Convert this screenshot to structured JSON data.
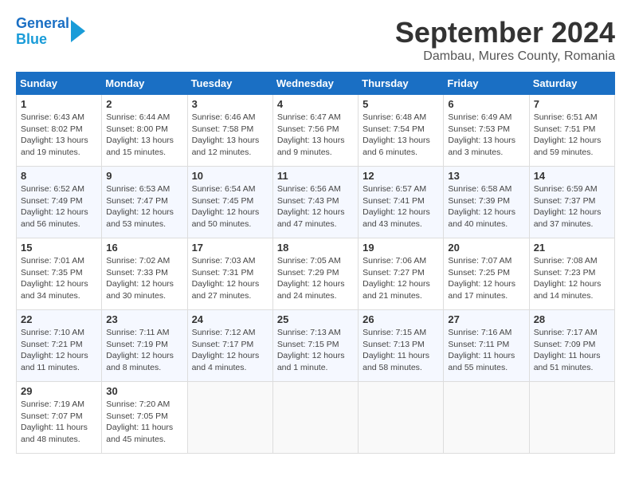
{
  "header": {
    "logo_line1": "General",
    "logo_line2": "Blue",
    "month_title": "September 2024",
    "subtitle": "Dambau, Mures County, Romania"
  },
  "days_of_week": [
    "Sunday",
    "Monday",
    "Tuesday",
    "Wednesday",
    "Thursday",
    "Friday",
    "Saturday"
  ],
  "weeks": [
    [
      {
        "day": 1,
        "info": "Sunrise: 6:43 AM\nSunset: 8:02 PM\nDaylight: 13 hours\nand 19 minutes."
      },
      {
        "day": 2,
        "info": "Sunrise: 6:44 AM\nSunset: 8:00 PM\nDaylight: 13 hours\nand 15 minutes."
      },
      {
        "day": 3,
        "info": "Sunrise: 6:46 AM\nSunset: 7:58 PM\nDaylight: 13 hours\nand 12 minutes."
      },
      {
        "day": 4,
        "info": "Sunrise: 6:47 AM\nSunset: 7:56 PM\nDaylight: 13 hours\nand 9 minutes."
      },
      {
        "day": 5,
        "info": "Sunrise: 6:48 AM\nSunset: 7:54 PM\nDaylight: 13 hours\nand 6 minutes."
      },
      {
        "day": 6,
        "info": "Sunrise: 6:49 AM\nSunset: 7:53 PM\nDaylight: 13 hours\nand 3 minutes."
      },
      {
        "day": 7,
        "info": "Sunrise: 6:51 AM\nSunset: 7:51 PM\nDaylight: 12 hours\nand 59 minutes."
      }
    ],
    [
      {
        "day": 8,
        "info": "Sunrise: 6:52 AM\nSunset: 7:49 PM\nDaylight: 12 hours\nand 56 minutes."
      },
      {
        "day": 9,
        "info": "Sunrise: 6:53 AM\nSunset: 7:47 PM\nDaylight: 12 hours\nand 53 minutes."
      },
      {
        "day": 10,
        "info": "Sunrise: 6:54 AM\nSunset: 7:45 PM\nDaylight: 12 hours\nand 50 minutes."
      },
      {
        "day": 11,
        "info": "Sunrise: 6:56 AM\nSunset: 7:43 PM\nDaylight: 12 hours\nand 47 minutes."
      },
      {
        "day": 12,
        "info": "Sunrise: 6:57 AM\nSunset: 7:41 PM\nDaylight: 12 hours\nand 43 minutes."
      },
      {
        "day": 13,
        "info": "Sunrise: 6:58 AM\nSunset: 7:39 PM\nDaylight: 12 hours\nand 40 minutes."
      },
      {
        "day": 14,
        "info": "Sunrise: 6:59 AM\nSunset: 7:37 PM\nDaylight: 12 hours\nand 37 minutes."
      }
    ],
    [
      {
        "day": 15,
        "info": "Sunrise: 7:01 AM\nSunset: 7:35 PM\nDaylight: 12 hours\nand 34 minutes."
      },
      {
        "day": 16,
        "info": "Sunrise: 7:02 AM\nSunset: 7:33 PM\nDaylight: 12 hours\nand 30 minutes."
      },
      {
        "day": 17,
        "info": "Sunrise: 7:03 AM\nSunset: 7:31 PM\nDaylight: 12 hours\nand 27 minutes."
      },
      {
        "day": 18,
        "info": "Sunrise: 7:05 AM\nSunset: 7:29 PM\nDaylight: 12 hours\nand 24 minutes."
      },
      {
        "day": 19,
        "info": "Sunrise: 7:06 AM\nSunset: 7:27 PM\nDaylight: 12 hours\nand 21 minutes."
      },
      {
        "day": 20,
        "info": "Sunrise: 7:07 AM\nSunset: 7:25 PM\nDaylight: 12 hours\nand 17 minutes."
      },
      {
        "day": 21,
        "info": "Sunrise: 7:08 AM\nSunset: 7:23 PM\nDaylight: 12 hours\nand 14 minutes."
      }
    ],
    [
      {
        "day": 22,
        "info": "Sunrise: 7:10 AM\nSunset: 7:21 PM\nDaylight: 12 hours\nand 11 minutes."
      },
      {
        "day": 23,
        "info": "Sunrise: 7:11 AM\nSunset: 7:19 PM\nDaylight: 12 hours\nand 8 minutes."
      },
      {
        "day": 24,
        "info": "Sunrise: 7:12 AM\nSunset: 7:17 PM\nDaylight: 12 hours\nand 4 minutes."
      },
      {
        "day": 25,
        "info": "Sunrise: 7:13 AM\nSunset: 7:15 PM\nDaylight: 12 hours\nand 1 minute."
      },
      {
        "day": 26,
        "info": "Sunrise: 7:15 AM\nSunset: 7:13 PM\nDaylight: 11 hours\nand 58 minutes."
      },
      {
        "day": 27,
        "info": "Sunrise: 7:16 AM\nSunset: 7:11 PM\nDaylight: 11 hours\nand 55 minutes."
      },
      {
        "day": 28,
        "info": "Sunrise: 7:17 AM\nSunset: 7:09 PM\nDaylight: 11 hours\nand 51 minutes."
      }
    ],
    [
      {
        "day": 29,
        "info": "Sunrise: 7:19 AM\nSunset: 7:07 PM\nDaylight: 11 hours\nand 48 minutes."
      },
      {
        "day": 30,
        "info": "Sunrise: 7:20 AM\nSunset: 7:05 PM\nDaylight: 11 hours\nand 45 minutes."
      },
      null,
      null,
      null,
      null,
      null
    ]
  ]
}
